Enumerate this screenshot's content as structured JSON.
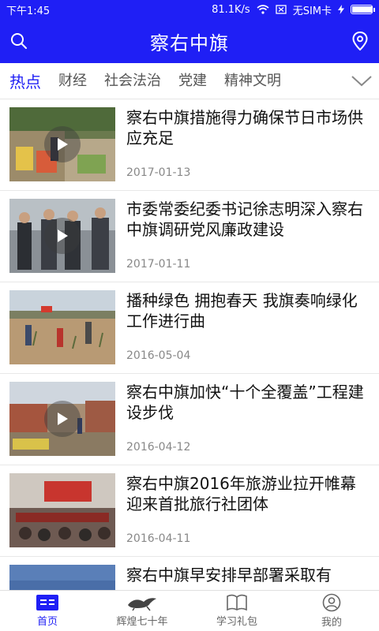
{
  "status_bar": {
    "time": "下午1:45",
    "net_speed": "81.1K/s",
    "sim": "无SIM卡",
    "battery_level": 0.95
  },
  "header": {
    "title": "察右中旗"
  },
  "channels": {
    "active": "热点",
    "items": [
      "热点",
      "财经",
      "社会法治",
      "党建",
      "精神文明"
    ]
  },
  "news": [
    {
      "title": "察右中旗措施得力确保节日市场供应充足",
      "date": "2017-01-13",
      "has_video": true
    },
    {
      "title": "市委常委纪委书记徐志明深入察右中旗调研党风廉政建设",
      "date": "2017-01-11",
      "has_video": true
    },
    {
      "title": "播种绿色 拥抱春天 我旗奏响绿化工作进行曲",
      "date": "2016-05-04",
      "has_video": false
    },
    {
      "title": "察右中旗加快“十个全覆盖”工程建设步伐",
      "date": "2016-04-12",
      "has_video": true
    },
    {
      "title": "察右中旗2016年旅游业拉开帷幕 迎来首批旅行社团体",
      "date": "2016-04-11",
      "has_video": false
    },
    {
      "title": "察右中旗早安排早部署采取有",
      "date": "",
      "has_video": false
    }
  ],
  "bottom_nav": [
    {
      "label": "首页",
      "icon": "news-icon",
      "active": true
    },
    {
      "label": "辉煌七十年",
      "icon": "horse-icon",
      "active": false
    },
    {
      "label": "学习礼包",
      "icon": "book-icon",
      "active": false
    },
    {
      "label": "我的",
      "icon": "user-icon",
      "active": false
    }
  ],
  "colors": {
    "brand": "#1f1ff5",
    "text_primary": "#111111",
    "text_secondary": "#888888"
  }
}
